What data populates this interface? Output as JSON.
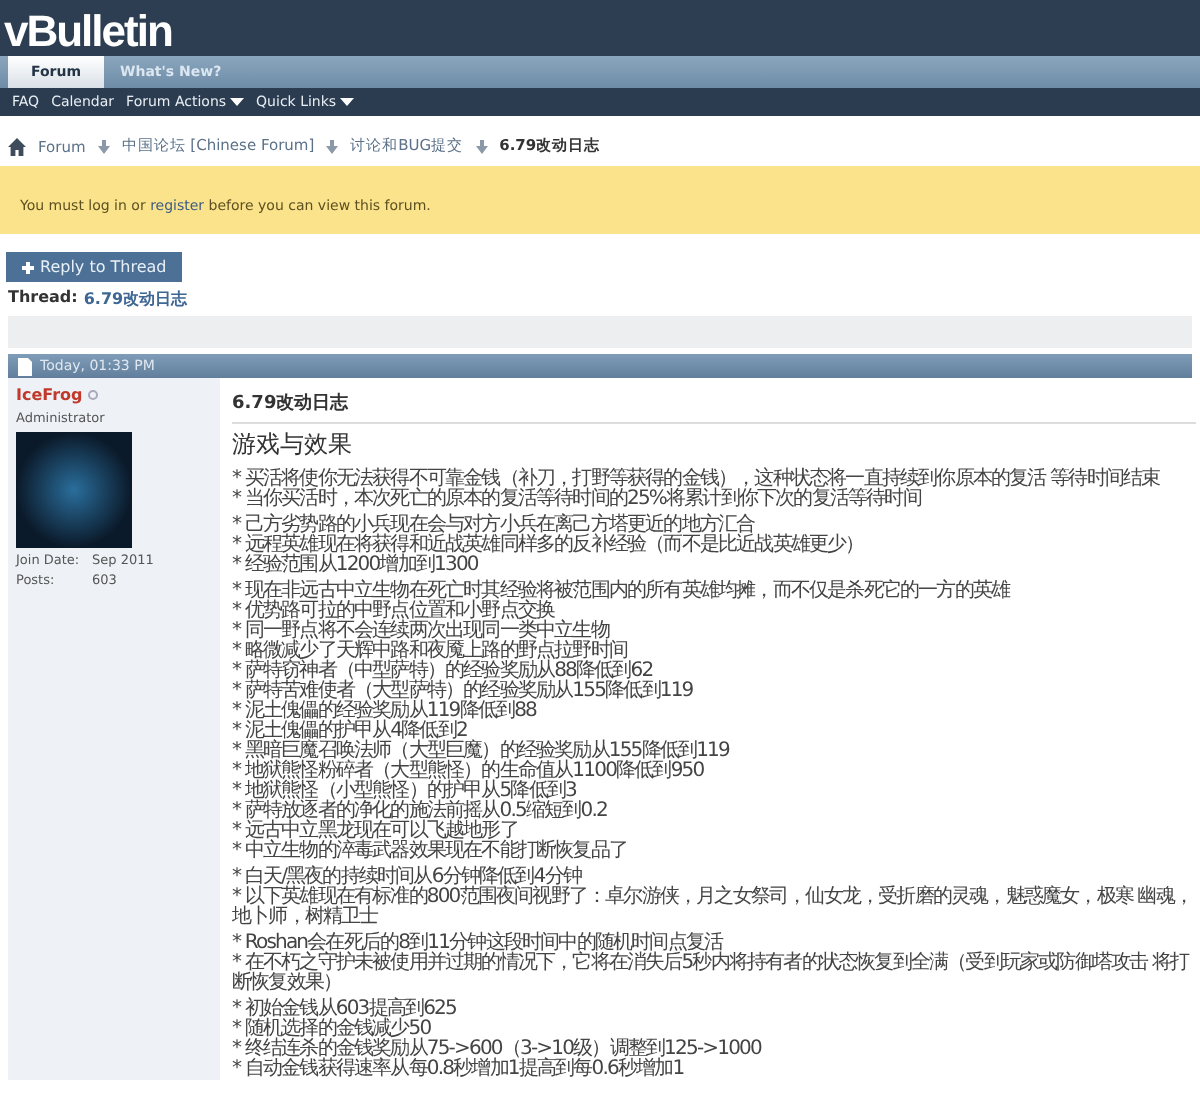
{
  "header": {
    "logo": "vBulletin"
  },
  "tabs": [
    {
      "label": "Forum",
      "selected": true
    },
    {
      "label": "What's New?",
      "selected": false
    }
  ],
  "subnav": [
    {
      "label": "FAQ",
      "dropdown": false
    },
    {
      "label": "Calendar",
      "dropdown": false
    },
    {
      "label": "Forum Actions",
      "dropdown": true
    },
    {
      "label": "Quick Links",
      "dropdown": true
    }
  ],
  "breadcrumb": [
    "Forum",
    "中国论坛 [Chinese Forum]",
    "讨论和BUG提交",
    "6.79改动日志"
  ],
  "notice": {
    "before": "You must log in or",
    "link": "register",
    "after": "before you can view this forum."
  },
  "reply_button": {
    "label": "Reply to Thread"
  },
  "thread": {
    "label": "Thread:",
    "title": "6.79改动日志"
  },
  "post": {
    "date": "Today, 01:33 PM",
    "author": {
      "name": "IceFrog",
      "title": "Administrator",
      "join_date_label": "Join Date:",
      "join_date": "Sep 2011",
      "posts_label": "Posts:",
      "posts": "603"
    },
    "title": "6.79改动日志",
    "heading": "游戏与效果",
    "groups": [
      [
        "* 买活将使你无法获得不可靠金钱（补刀，打野等获得的金钱），这种状态将一直持续到你原本的复活 等待时间结束",
        "* 当你买活时，本次死亡的原本的复活等待时间的25%将累计到你下次的复活等待时间"
      ],
      [
        "* 己方劣势路的小兵现在会与对方小兵在离己方塔更近的地方汇合",
        "* 远程英雄现在将获得和近战英雄同样多的反补经验（而不是比近战英雄更少）",
        "* 经验范围从1200增加到1300"
      ],
      [
        "* 现在非远古中立生物在死亡时其经验将被范围内的所有英雄均摊，而不仅是杀死它的一方的英雄",
        "* 优势路可拉的中野点位置和小野点交换",
        "* 同一野点将不会连续两次出现同一类中立生物",
        "* 略微减少了天辉中路和夜魇上路的野点拉野时间",
        "* 萨特窃神者（中型萨特）的经验奖励从88降低到62",
        "* 萨特苦难使者（大型萨特）的经验奖励从155降低到119",
        "* 泥土傀儡的经验奖励从119降低到88",
        "* 泥土傀儡的护甲从4降低到2",
        "* 黑暗巨魔召唤法师（大型巨魔）的经验奖励从155降低到119",
        "* 地狱熊怪粉碎者（大型熊怪）的生命值从1100降低到950",
        "* 地狱熊怪（小型熊怪）的护甲从5降低到3",
        "* 萨特放逐者的净化的施法前摇从0.5缩短到0.2",
        "* 远古中立黑龙现在可以飞越地形了",
        "* 中立生物的淬毒武器效果现在不能打断恢复品了"
      ],
      [
        "* 白天/黑夜的持续时间从6分钟降低到4分钟",
        "* 以下英雄现在有标准的800范围夜间视野了：卓尔游侠，月之女祭司，仙女龙，受折磨的灵魂，魅惑魔女，极寒 幽魂，地卜师，树精卫士"
      ],
      [
        "* Roshan会在死后的8到11分钟这段时间中的随机时间点复活",
        "* 在不朽之守护未被使用并过期的情况下，它将在消失后5秒内将持有者的状态恢复到全满（受到玩家或防御塔攻击 将打断恢复效果）"
      ],
      [
        "* 初始金钱从603提高到625",
        "* 随机选择的金钱减少50",
        "* 终结连杀的金钱奖励从75->600（3->10级）调整到125->1000",
        "* 自动金钱获得速率从每0.8秒增加1提高到每0.6秒增加1"
      ]
    ]
  }
}
